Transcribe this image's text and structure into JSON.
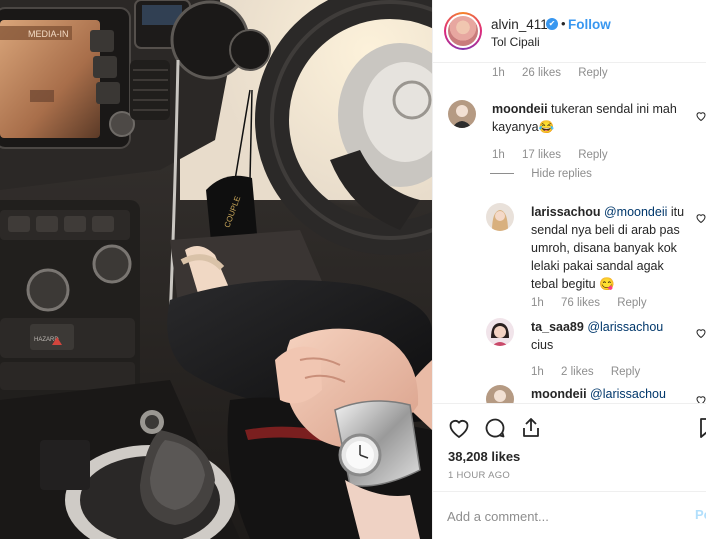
{
  "post": {
    "username": "alvin_411",
    "follow_label": "Follow",
    "location": "Tol Cipali",
    "separator": "•"
  },
  "comments": [
    {
      "type": "meta-only",
      "time": "1h",
      "likes": "26 likes",
      "reply": "Reply"
    },
    {
      "username": "moondeii",
      "text": "tukeran sendal ini mah kayanya😂",
      "time": "1h",
      "likes": "17 likes",
      "reply": "Reply",
      "hide_replies": "Hide replies"
    },
    {
      "username": "larissachou",
      "mention": "@moondeii",
      "text": "itu sendal nya beli di arab pas umroh, disana banyak kok lelaki pakai sandal agak tebal begitu 😋",
      "time": "1h",
      "likes": "76 likes",
      "reply": "Reply"
    },
    {
      "username": "ta_saa89",
      "mention": "@larissachou",
      "text": "cius",
      "time": "1h",
      "likes": "2 likes",
      "reply": "Reply"
    },
    {
      "username": "moondeii",
      "mention": "@larissachou"
    }
  ],
  "engagement": {
    "likes": "38,208 likes",
    "time_ago": "1 HOUR AGO"
  },
  "composer": {
    "placeholder": "Add a comment...",
    "post_label": "Po"
  },
  "photo": {
    "car_display_text": "MEDIA-IN",
    "tag_text": "COUPLE",
    "dashboard_button_text": "HAZARD"
  },
  "icons": {
    "like": "heart-icon",
    "comment": "comment-icon",
    "share": "share-icon",
    "save": "bookmark-icon",
    "verified": "verified-badge-icon"
  },
  "colors": {
    "accent": "#3897f0",
    "text": "#262626",
    "muted": "#8e8e8e",
    "mention": "#00376b",
    "border": "#efefef"
  }
}
